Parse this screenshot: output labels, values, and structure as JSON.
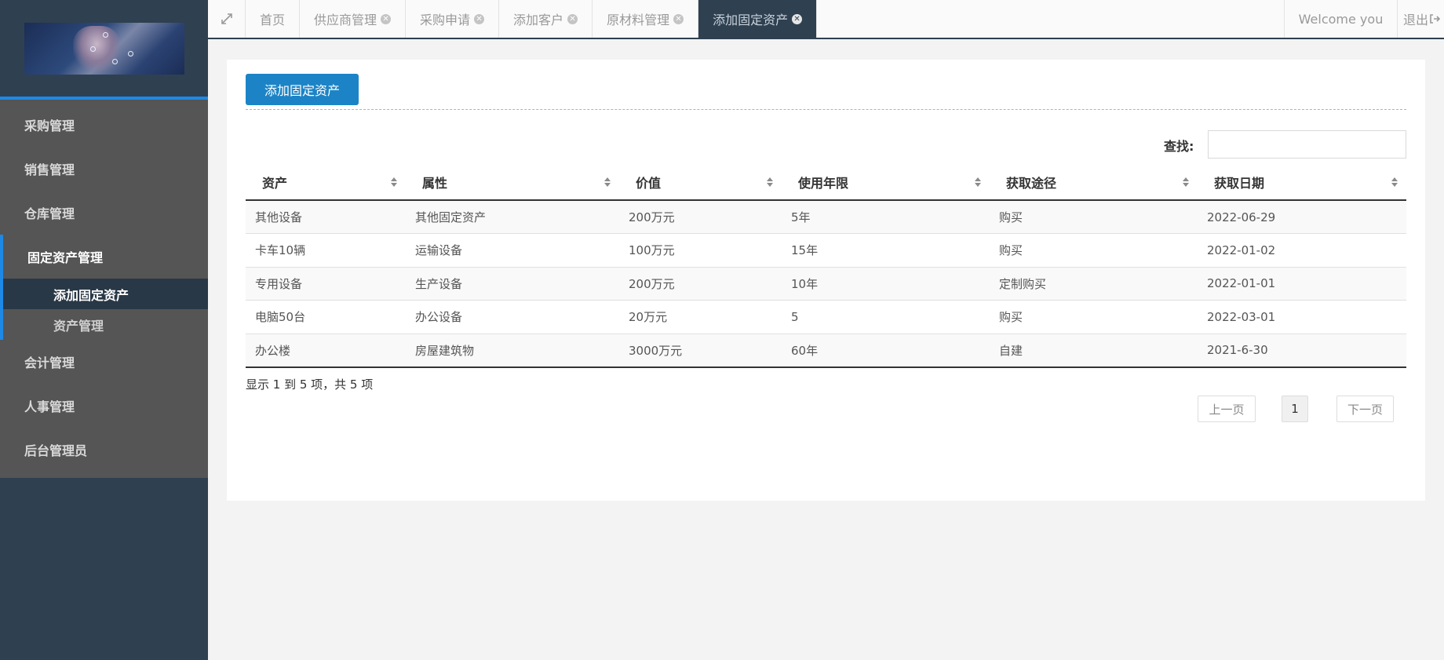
{
  "sidebar": {
    "menu_top": [
      {
        "label": "采购管理"
      },
      {
        "label": "销售管理"
      },
      {
        "label": "仓库管理"
      }
    ],
    "group": {
      "label": "固定资产管理",
      "sub_items": [
        {
          "label": "添加固定资产"
        },
        {
          "label": "资产管理"
        }
      ]
    },
    "menu_bottom": [
      {
        "label": "会计管理"
      },
      {
        "label": "人事管理"
      },
      {
        "label": "后台管理员"
      }
    ]
  },
  "topbar": {
    "tabs": [
      {
        "label": "首页"
      },
      {
        "label": "供应商管理"
      },
      {
        "label": "采购申请"
      },
      {
        "label": "添加客户"
      },
      {
        "label": "原材料管理"
      },
      {
        "label": "添加固定资产"
      }
    ],
    "welcome": "Welcome you",
    "logout": "退出"
  },
  "main": {
    "add_button": "添加固定资产",
    "search_label": "查找:",
    "search_value": "",
    "table": {
      "headers": [
        "资产",
        "属性",
        "价值",
        "使用年限",
        "获取途径",
        "获取日期"
      ],
      "rows": [
        [
          "其他设备",
          "其他固定资产",
          "200万元",
          "5年",
          "购买",
          "2022-06-29"
        ],
        [
          "卡车10辆",
          "运输设备",
          "100万元",
          "15年",
          "购买",
          "2022-01-02"
        ],
        [
          "专用设备",
          "生产设备",
          "200万元",
          "10年",
          "定制购买",
          "2022-01-01"
        ],
        [
          "电脑50台",
          "办公设备",
          "20万元",
          "5",
          "购买",
          "2022-03-01"
        ],
        [
          "办公楼",
          "房屋建筑物",
          "3000万元",
          "60年",
          "自建",
          "2021-6-30"
        ]
      ]
    },
    "info": "显示 1 到 5 项，共 5 项",
    "pagination": {
      "prev": "上一页",
      "current": "1",
      "next": "下一页"
    }
  },
  "colors": {
    "sidebar_bg": "#2f4050",
    "accent": "#1c84c6",
    "nav_block": "#555555"
  }
}
